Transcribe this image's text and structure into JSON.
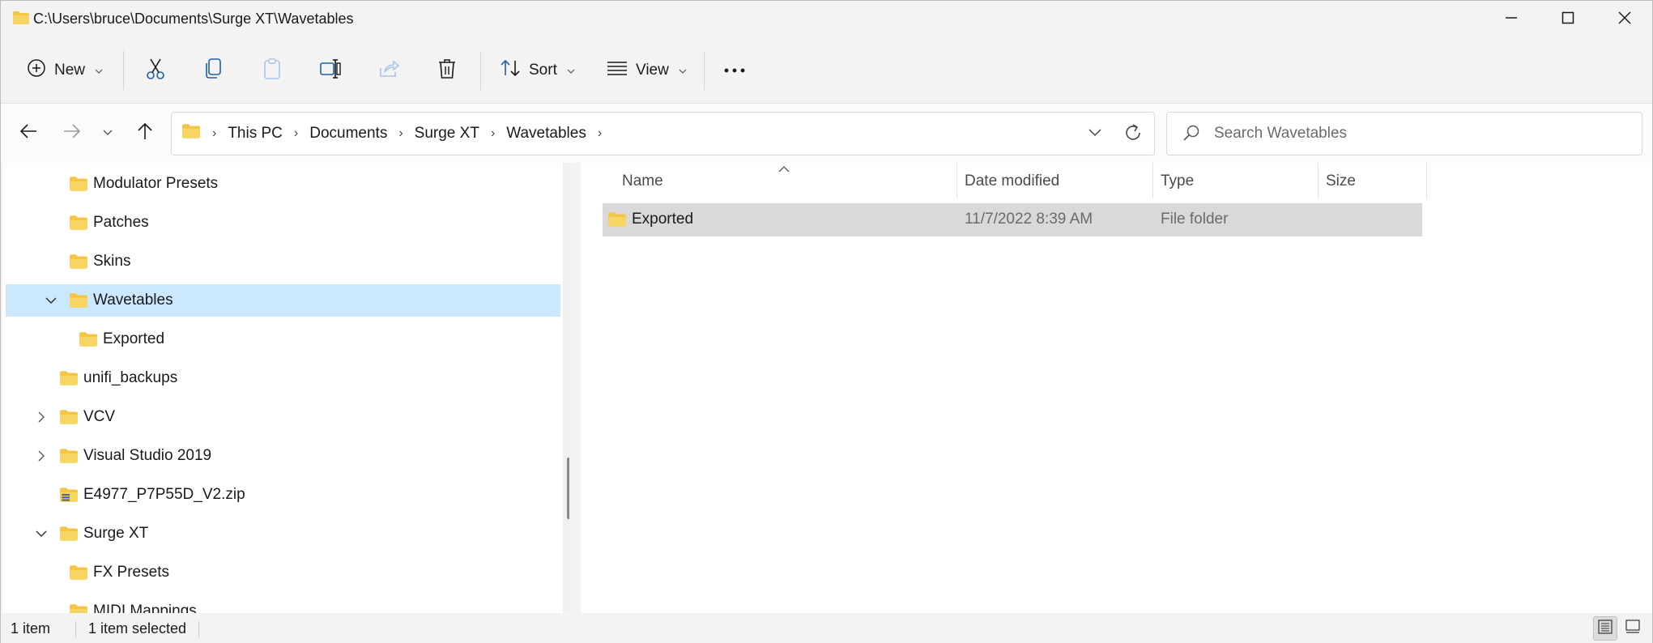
{
  "window": {
    "title": "C:\\Users\\bruce\\Documents\\Surge XT\\Wavetables",
    "minimize_icon": "minimize-icon",
    "maximize_icon": "maximize-icon",
    "close_icon": "close-icon"
  },
  "toolbar": {
    "new_label": "New",
    "sort_label": "Sort",
    "view_label": "View",
    "icons": [
      "plus-circle-icon",
      "cut-icon",
      "copy-icon",
      "paste-icon",
      "rename-icon",
      "share-icon",
      "delete-icon",
      "sort-icon",
      "view-icon",
      "more-icon"
    ]
  },
  "address": {
    "crumbs": [
      "This PC",
      "Documents",
      "Surge XT",
      "Wavetables"
    ]
  },
  "search": {
    "placeholder": "Search Wavetables",
    "value": ""
  },
  "nav_tree": {
    "items": [
      {
        "label": "Modulator Presets",
        "expander": "",
        "selected": false
      },
      {
        "label": "Patches",
        "expander": "",
        "selected": false
      },
      {
        "label": "Skins",
        "expander": "",
        "selected": false
      },
      {
        "label": "Wavetables",
        "expander": "expanded",
        "selected": true
      },
      {
        "label": "Exported",
        "expander": "",
        "selected": false
      },
      {
        "label": "unifi_backups",
        "expander": "",
        "selected": false
      },
      {
        "label": "VCV",
        "expander": "collapsed",
        "selected": false
      },
      {
        "label": "Visual Studio 2019",
        "expander": "collapsed",
        "selected": false
      },
      {
        "label": "E4977_P7P55D_V2.zip",
        "expander": "",
        "selected": false,
        "icon": "zip-folder-icon"
      },
      {
        "label": "Surge XT",
        "expander": "expanded",
        "selected": false
      },
      {
        "label": "FX Presets",
        "expander": "",
        "selected": false
      },
      {
        "label": "MIDI Mappings",
        "expander": "",
        "selected": false
      }
    ]
  },
  "file_list": {
    "columns": [
      "Name",
      "Date modified",
      "Type",
      "Size"
    ],
    "sort_column": "Name",
    "rows": [
      {
        "name": "Exported",
        "date_modified": "11/7/2022 8:39 AM",
        "type": "File folder",
        "size": "",
        "selected": true
      }
    ]
  },
  "status": {
    "item_count": "1 item",
    "selection": "1 item selected",
    "view_mode": "details"
  },
  "colors": {
    "folder": "#f4c542",
    "selection_nav": "#cce8ff",
    "selection_row": "#d9d9d9"
  }
}
